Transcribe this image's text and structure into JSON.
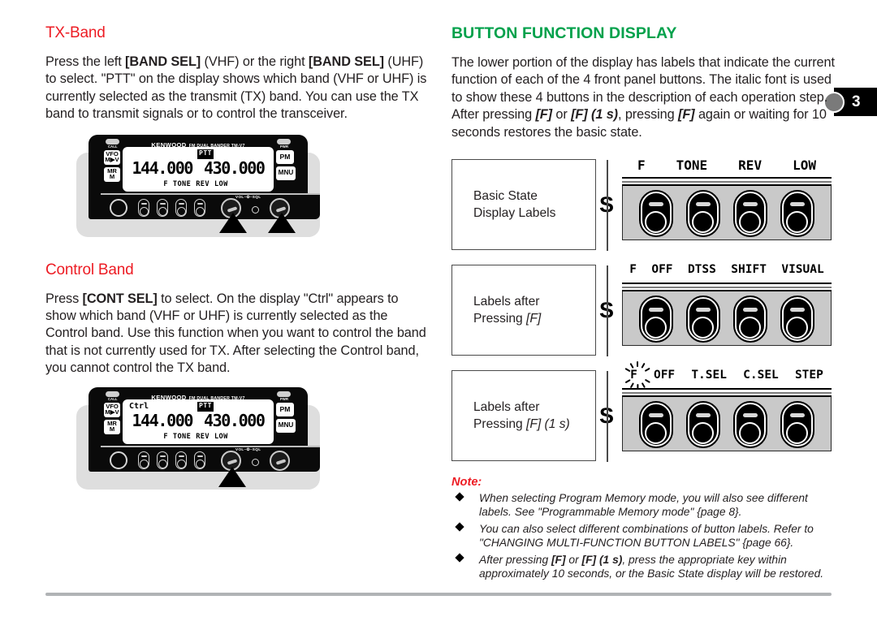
{
  "page_number": "3",
  "colors": {
    "heading_sub": "#ed1c24",
    "heading_section": "#00a14b",
    "note_title": "#ed1c24"
  },
  "left_column": {
    "tx_band": {
      "heading": "TX-Band",
      "paragraph_parts": [
        {
          "t": "Press the left ",
          "s": "n"
        },
        {
          "t": "[BAND SEL]",
          "s": "b"
        },
        {
          "t": " (VHF) or the right ",
          "s": "n"
        },
        {
          "t": "[BAND SEL]",
          "s": "b"
        },
        {
          "t": " (UHF) to select.  \"PTT\" on the display shows which band (VHF or UHF) is currently selected as the transmit (TX) band.  You can use the TX band to transmit signals or to control the transceiver.",
          "s": "n"
        }
      ]
    },
    "control_band": {
      "heading": "Control Band",
      "paragraph_parts": [
        {
          "t": "Press ",
          "s": "n"
        },
        {
          "t": "[CONT SEL]",
          "s": "b"
        },
        {
          "t": " to select.  On the display \"Ctrl\" appears to show which band (VHF or UHF) is currently selected as the Control band.  Use this function when you want to control the band that is not currently used for TX.  After selecting the Control band, you cannot control the TX band.",
          "s": "n"
        }
      ]
    }
  },
  "radio": {
    "brand": "KENWOOD",
    "brand_sub": "FM DUAL BANDER   TM-V7",
    "side_buttons": {
      "vfo_top": "VFO",
      "vfo_bottom": "M▶V",
      "mr_top": "MR",
      "mr_bottom": "M",
      "pm": "PM",
      "mnu": "MNU",
      "call": "CALL",
      "pwr": "PWR"
    },
    "vol_sql_label": "VOL–✪–SQL",
    "display": {
      "ptt": "PTT",
      "ctrl": "Ctrl",
      "freq_left": "144.000",
      "freq_right": "430.000",
      "annunciators": [
        "F",
        "TONE",
        "REV",
        "LOW"
      ]
    }
  },
  "right_column": {
    "section_heading": "BUTTON FUNCTION DISPLAY",
    "intro_parts": [
      {
        "t": "The lower portion of the display has labels that indicate the current function of each of the 4 front panel buttons.  The italic font is used to show these 4 buttons in the description of each operation step.  After pressing ",
        "s": "n"
      },
      {
        "t": "[F]",
        "s": "i"
      },
      {
        "t": " or ",
        "s": "n"
      },
      {
        "t": "[F] (1 s)",
        "s": "i"
      },
      {
        "t": ", pressing ",
        "s": "n"
      },
      {
        "t": "[F]",
        "s": "i"
      },
      {
        "t": " again or waiting for 10 seconds restores the basic state.",
        "s": "n"
      }
    ],
    "rows": [
      {
        "box_line1": "Basic State",
        "box_line2": "Display Labels",
        "box_line2_italic": "",
        "arrow_glyph": "S",
        "button_labels": [
          "F",
          "TONE",
          "REV",
          "LOW"
        ],
        "f_blinking": false,
        "f_bold": false
      },
      {
        "box_line1": "Labels after",
        "box_line2": "Pressing ",
        "box_line2_italic": "[F]",
        "arrow_glyph": "S",
        "button_labels": [
          "F",
          "OFF",
          "DTSS",
          "SHIFT",
          "VISUAL"
        ],
        "f_blinking": false,
        "f_bold": true
      },
      {
        "box_line1": "Labels after",
        "box_line2": "Pressing ",
        "box_line2_italic": "[F] (1 s)",
        "arrow_glyph": "S",
        "button_labels": [
          "F",
          "OFF",
          "T.SEL",
          "C.SEL",
          "STEP"
        ],
        "f_blinking": true,
        "f_bold": true
      }
    ]
  },
  "note": {
    "title": "Note:",
    "items": [
      [
        {
          "t": "When selecting Program Memory mode, you will also see different labels.  See \"Programmable Memory mode\" {page 8}.",
          "s": "n"
        }
      ],
      [
        {
          "t": "You can also select different combinations of button labels.  Refer to \"CHANGING MULTI-FUNCTION BUTTON LABELS\" {page 66}.",
          "s": "n"
        }
      ],
      [
        {
          "t": "After pressing ",
          "s": "n"
        },
        {
          "t": "[F]",
          "s": "b"
        },
        {
          "t": " or ",
          "s": "n"
        },
        {
          "t": "[F] (1 s)",
          "s": "b"
        },
        {
          "t": ", press the appropriate key within approximately 10 seconds, or the Basic State display will be restored.",
          "s": "n"
        }
      ]
    ]
  }
}
